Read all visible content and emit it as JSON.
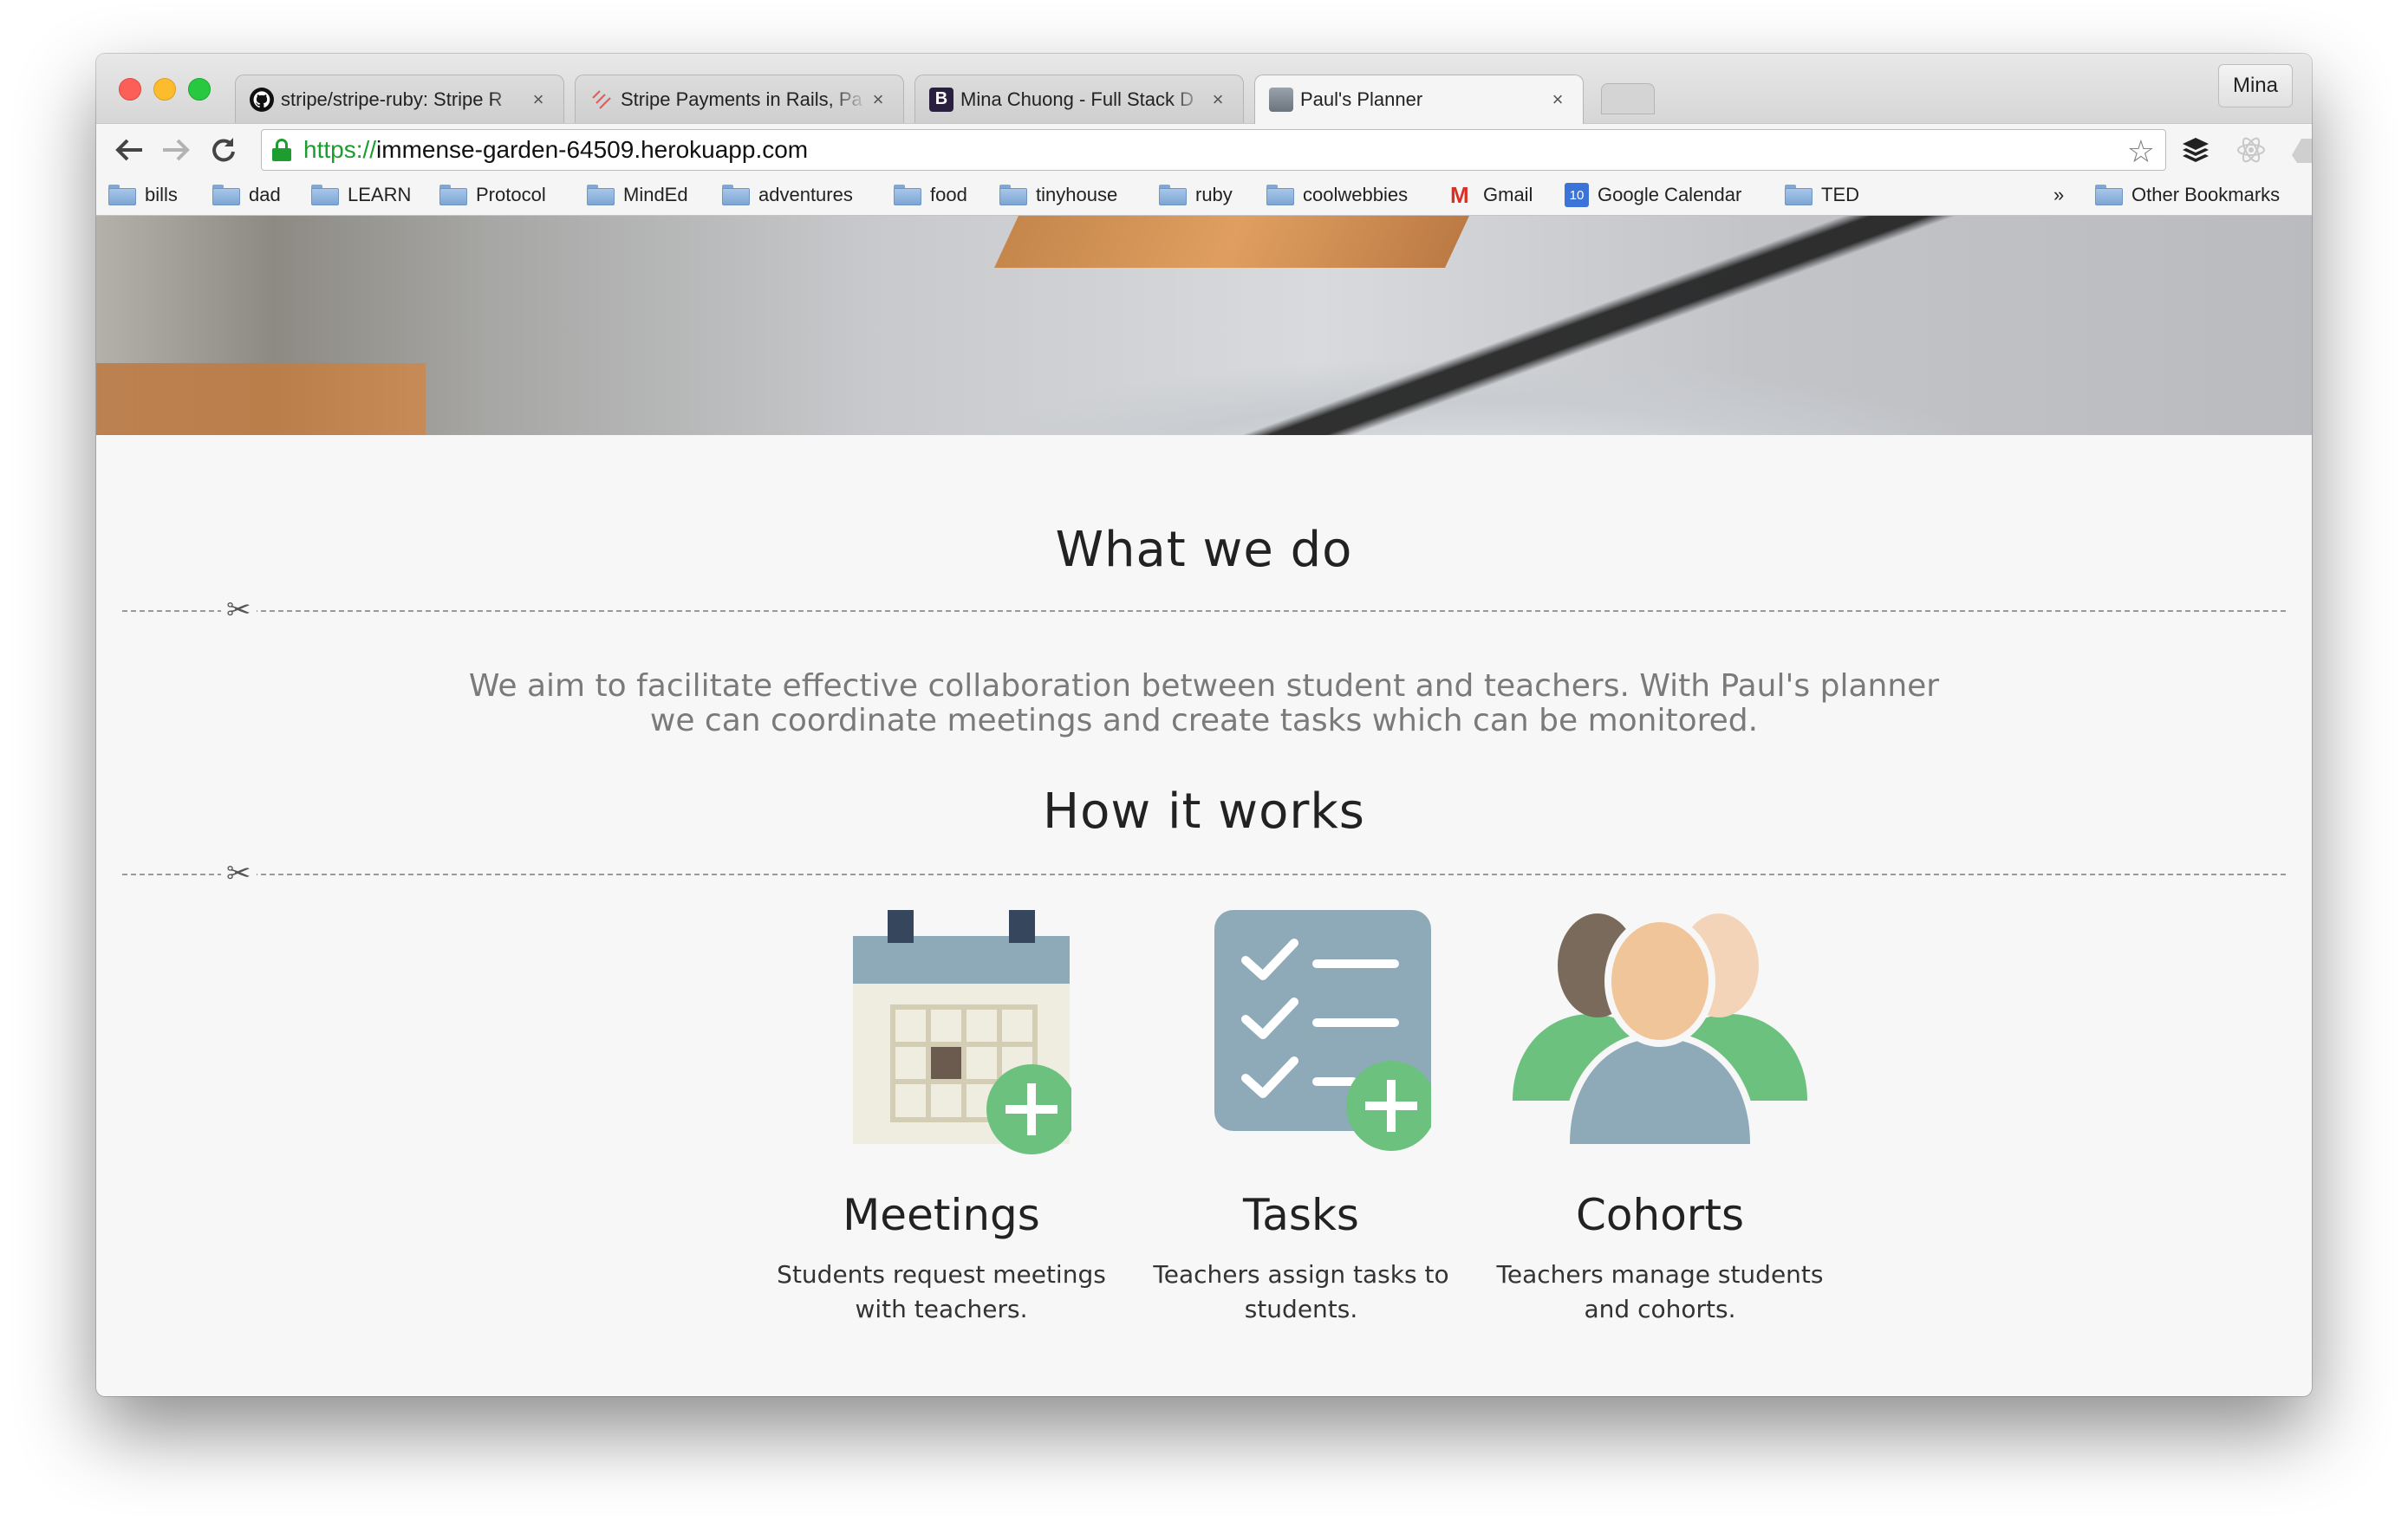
{
  "browser": {
    "tabs": [
      {
        "title": "stripe/stripe-ruby: Stripe R",
        "favicon": "github-icon"
      },
      {
        "title": "Stripe Payments in Rails, Pa",
        "favicon": "stripe-icon"
      },
      {
        "title": "Mina Chuong - Full Stack D",
        "favicon": "bootstrap-icon"
      },
      {
        "title": "Paul's Planner",
        "favicon": "avatar-icon"
      }
    ],
    "active_tab": 3,
    "close_glyph": "×",
    "profile_name": "Mina",
    "url_scheme": "https://",
    "url_rest": "immense-garden-64509.herokuapp.com",
    "bookmarks": [
      {
        "label": "bills",
        "icon": "folder-icon"
      },
      {
        "label": "dad",
        "icon": "folder-icon"
      },
      {
        "label": "LEARN",
        "icon": "folder-icon"
      },
      {
        "label": "Protocol",
        "icon": "folder-icon"
      },
      {
        "label": "MindEd",
        "icon": "folder-icon"
      },
      {
        "label": "adventures",
        "icon": "folder-icon"
      },
      {
        "label": "food",
        "icon": "folder-icon"
      },
      {
        "label": "tinyhouse",
        "icon": "folder-icon"
      },
      {
        "label": "ruby",
        "icon": "folder-icon"
      },
      {
        "label": "coolwebbies",
        "icon": "folder-icon"
      },
      {
        "label": "Gmail",
        "icon": "gmail-icon"
      },
      {
        "label": "Google Calendar",
        "icon": "calendar-icon"
      },
      {
        "label": "TED",
        "icon": "folder-icon"
      }
    ],
    "calendar_day": "10",
    "overflow_chevron": "»",
    "other_bookmarks": "Other Bookmarks"
  },
  "page": {
    "what_title": "What we do",
    "what_text_line1": "We aim to facilitate effective collaboration between student and teachers. With Paul's planner",
    "what_text_line2": "we can coordinate meetings and create tasks which can be monitored.",
    "how_title": "How it works",
    "scissors_glyph": "✂",
    "features": [
      {
        "name": "Meetings",
        "desc_line1": "Students request meetings",
        "desc_line2": "with teachers.",
        "icon": "calendar-add-icon"
      },
      {
        "name": "Tasks",
        "desc_line1": "Teachers assign tasks to",
        "desc_line2": "students.",
        "icon": "checklist-add-icon"
      },
      {
        "name": "Cohorts",
        "desc_line1": "Teachers manage students",
        "desc_line2": "and cohorts.",
        "icon": "group-icon"
      }
    ]
  },
  "colors": {
    "accent_green": "#6cc17f",
    "icon_slate": "#8aaabb",
    "page_bg": "#f7f7f7"
  }
}
